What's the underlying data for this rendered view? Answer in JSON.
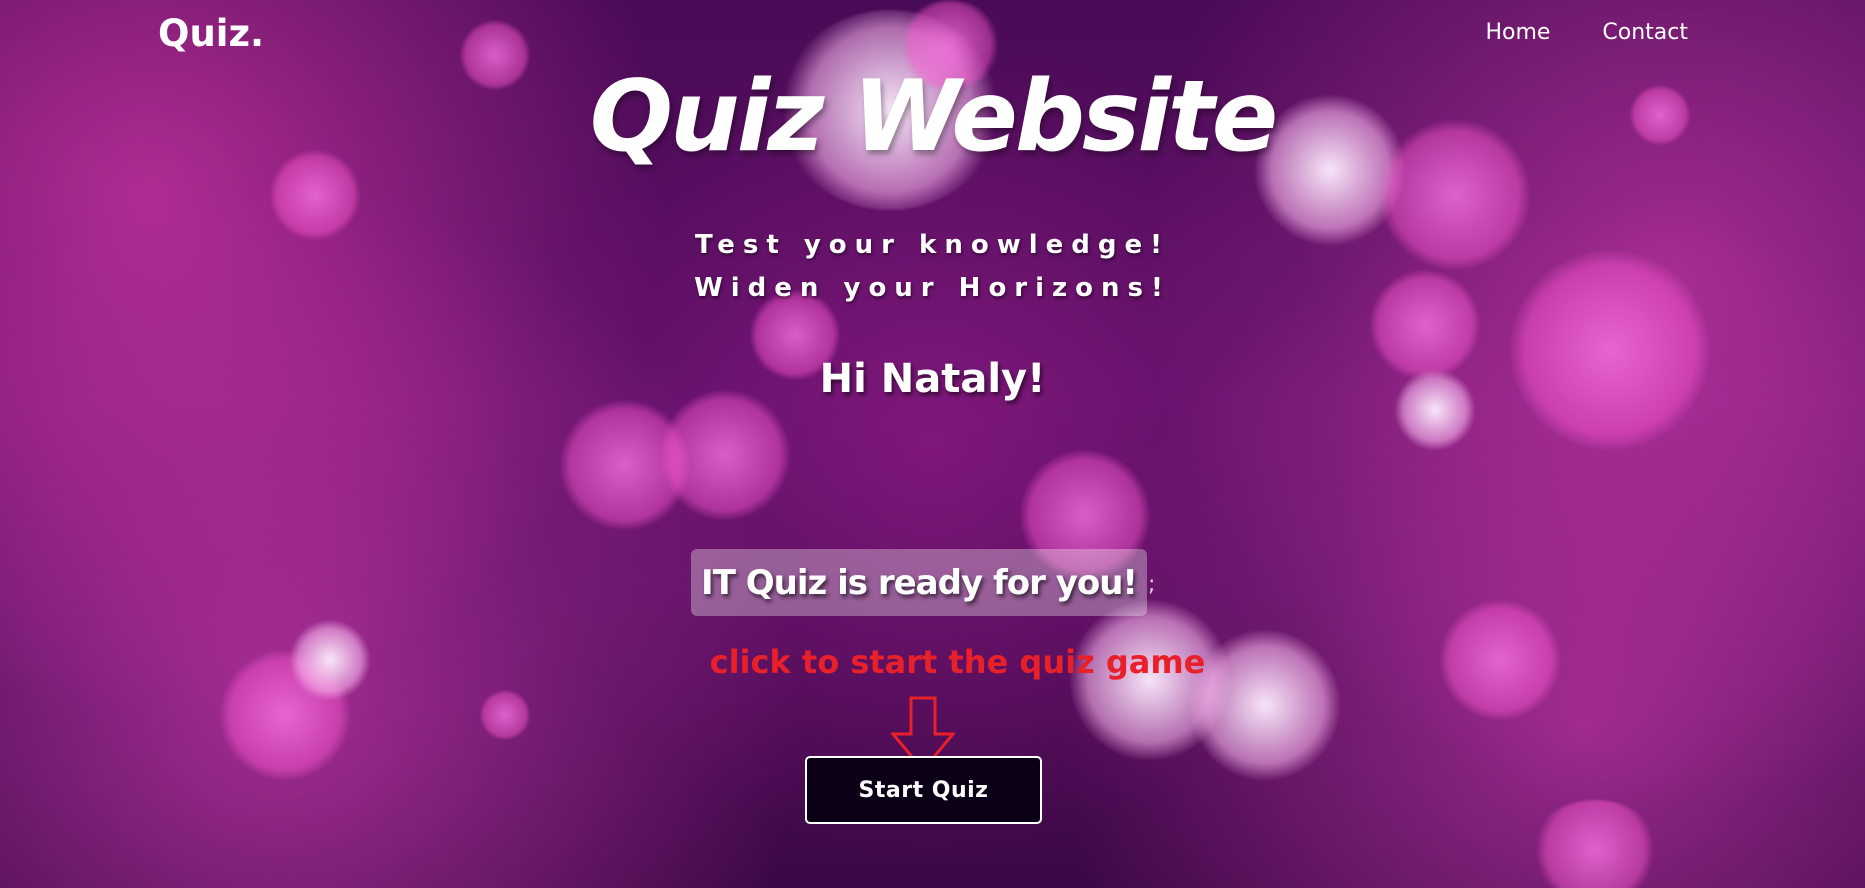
{
  "nav": {
    "logo": "Quiz.",
    "links": [
      "Home",
      "Contact"
    ]
  },
  "hero": {
    "title": "Quiz Website",
    "tagline_1": "Test your knowledge!",
    "tagline_2": "Widen your Horizons!",
    "greeting": "Hi Nataly!"
  },
  "quiz": {
    "ready_text": "IT Quiz is ready for you!",
    "trailing_char": ";",
    "hint": "click to start the quiz game",
    "start_label": "Start Quiz"
  },
  "colors": {
    "background": "#4a0b56",
    "accent_pink": "#ff5ad2",
    "hint_red": "#e8202a",
    "button_bg": "#0b0016"
  },
  "icons": {
    "hint_arrow": "down-arrow-icon"
  }
}
